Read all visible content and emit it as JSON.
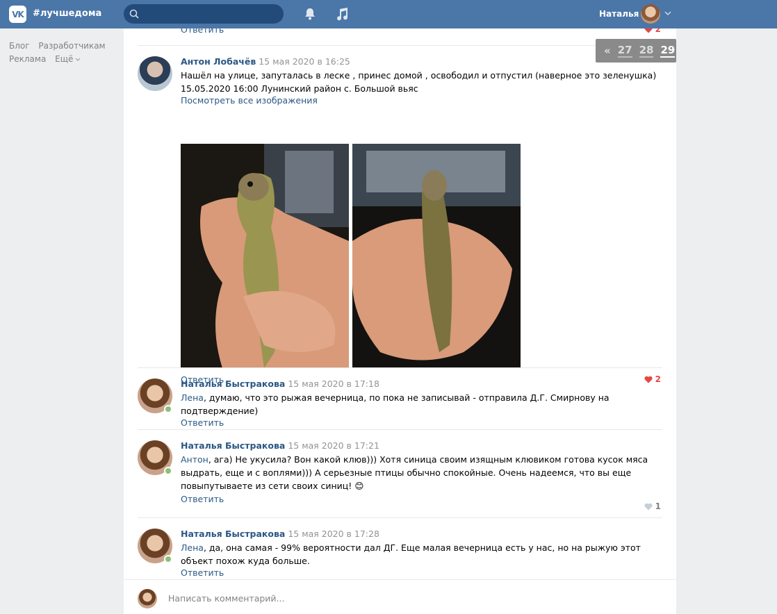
{
  "header": {
    "brand": "#лучшедома",
    "user_name": "Наталья"
  },
  "leftnav": {
    "blog": "Блог",
    "dev": "Разработчикам",
    "ads": "Реклама",
    "more": "Ещё"
  },
  "pager": {
    "prev": "«",
    "pages": [
      "27",
      "28",
      "29"
    ],
    "current": "29"
  },
  "top_reply": {
    "reply": "Ответить",
    "likes": "2"
  },
  "comments": [
    {
      "author": "Антон Лобачёв",
      "date": "15 мая 2020 в 16:25",
      "text": "Нашёл на улице, запуталась в леске , принес домой , освободил и отпустил (наверное это зеленушка) 15.05.2020 16:00 Лунинский район с. Большой вьяс",
      "view_all": "Посмотреть все изображения",
      "reply": "Ответить",
      "likes": "2"
    },
    {
      "author": "Наталья Быстракова",
      "date": "15 мая 2020 в 17:18",
      "mention": "Лена",
      "text": ", думаю, что это рыжая вечерница, по пока не записывай - отправила Д.Г. Смирнову на подтверждение)",
      "reply": "Ответить"
    },
    {
      "author": "Наталья Быстракова",
      "date": "15 мая 2020 в 17:21",
      "mention": "Антон",
      "text": ", ага) Не укусила? Вон какой клюв))) Хотя синица своим изящным клювиком готова кусок мяса выдрать, еще и с воплями))) А серьезные птицы обычно спокойные. Очень надеемся, что вы еще повыпутываете из сети своих синиц!",
      "emoji": "😊",
      "reply": "Ответить",
      "likes": "1"
    },
    {
      "author": "Наталья Быстракова",
      "date": "15 мая 2020 в 17:28",
      "mention": "Лена",
      "text": ", да, она самая - 99% вероятности дал ДГ. Еще малая вечерница есть у нас, но на рыжую этот объект похож куда больше.",
      "reply": "Ответить"
    }
  ],
  "composer": {
    "placeholder": "Написать комментарий..."
  },
  "colors": {
    "header": "#4a76a8",
    "link": "#2a5885",
    "like": "#e64646",
    "online": "#8ac176"
  }
}
